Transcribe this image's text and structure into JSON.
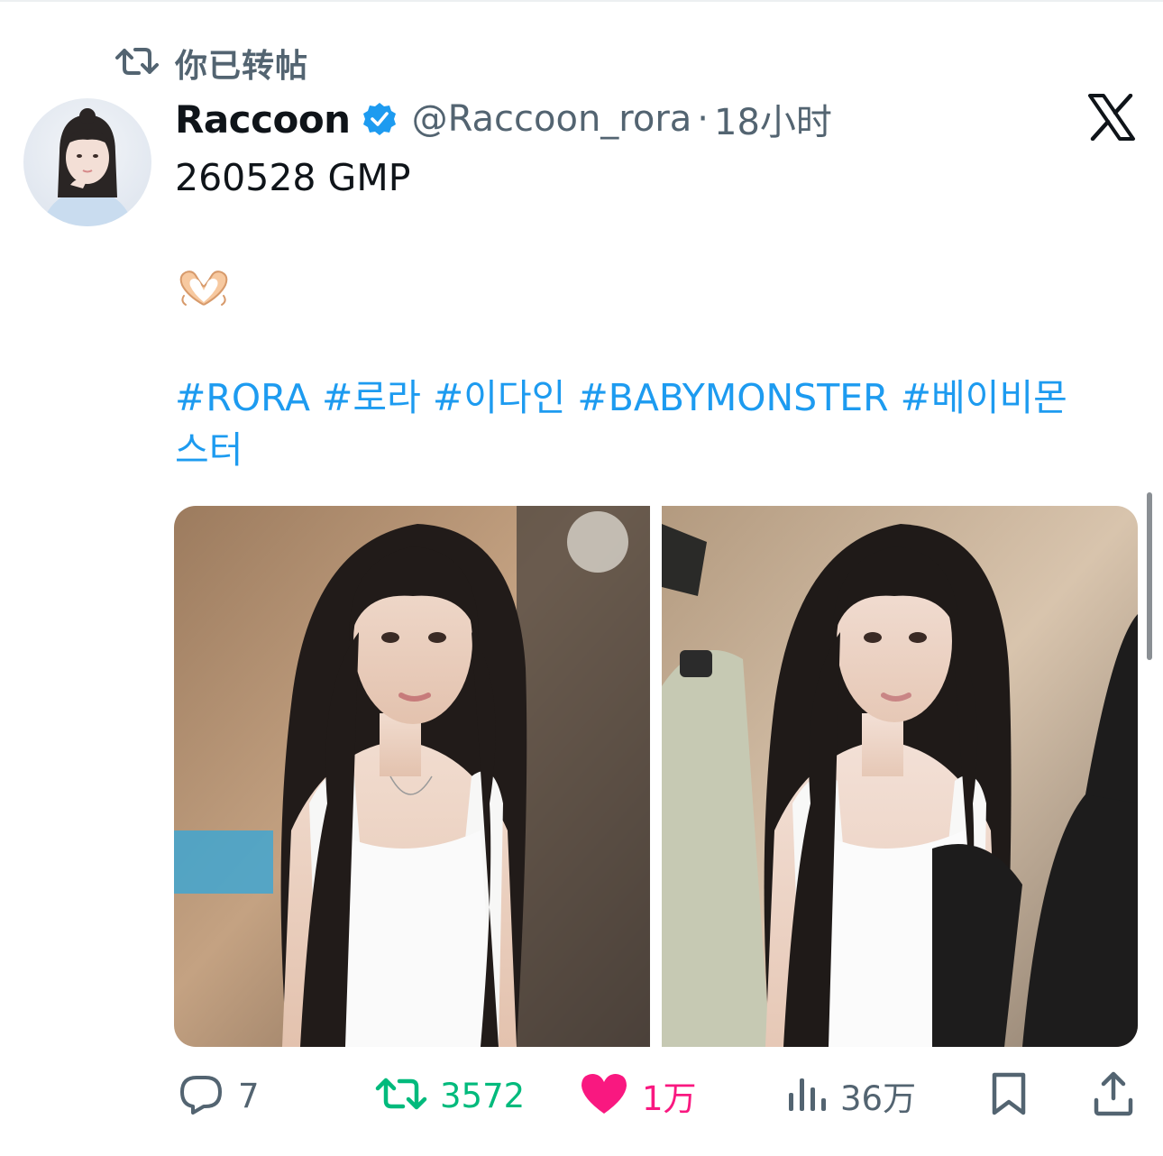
{
  "retweet_context": {
    "icon": "retweet-icon",
    "text": "你已转帖"
  },
  "author": {
    "display_name": "Raccoon",
    "verified_icon": "verified-badge-icon",
    "handle": "@Raccoon_rora",
    "separator": "·",
    "time": "18小时"
  },
  "platform_icon": "x-logo-icon",
  "tweet": {
    "line1": "260528 GMP",
    "emoji_icon": "heart-hands-icon",
    "hashtags_line1": "#RORA #로라 #이다인 #BABYMONSTER #베이비몬",
    "hashtags_line2": "스터"
  },
  "media": {
    "photos": [
      "photo-1",
      "photo-2"
    ]
  },
  "actions": {
    "reply": {
      "icon": "reply-icon",
      "count": "7"
    },
    "retweet": {
      "icon": "retweet-icon",
      "count": "3572"
    },
    "like": {
      "icon": "heart-icon",
      "count": "1万"
    },
    "views": {
      "icon": "views-icon",
      "count": "36万"
    },
    "bookmark": {
      "icon": "bookmark-icon"
    },
    "share": {
      "icon": "share-icon"
    }
  },
  "colors": {
    "text": "#0f1419",
    "secondary": "#536471",
    "link": "#1d9bf0",
    "retweet_active": "#00ba7c",
    "like_active": "#f91880",
    "verified": "#1d9bf0"
  }
}
